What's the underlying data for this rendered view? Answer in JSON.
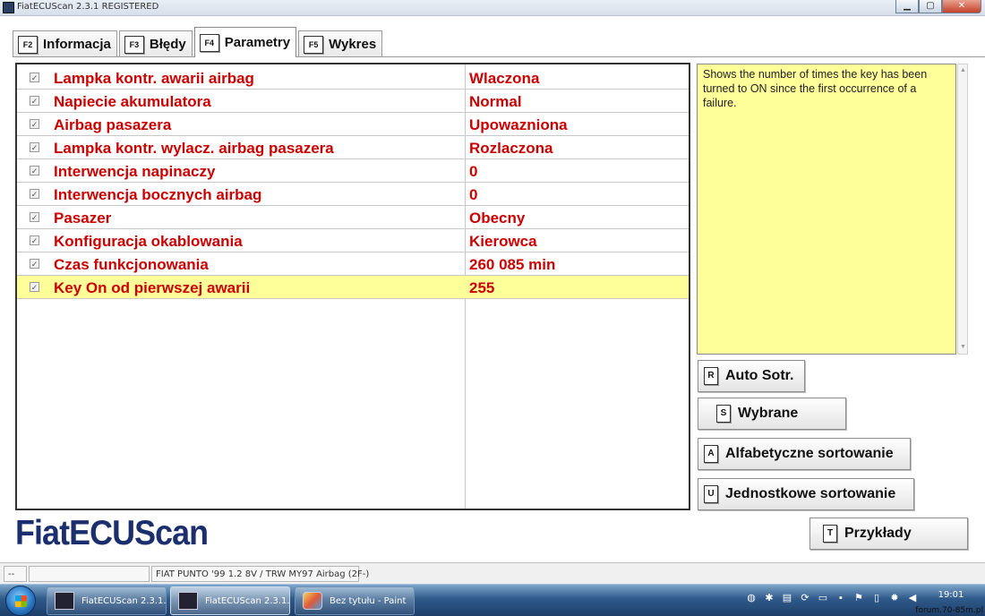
{
  "window": {
    "title": "FiatECUScan 2.3.1 REGISTERED",
    "minimize_glyph": "▁",
    "maximize_glyph": "▢",
    "close_glyph": "✕"
  },
  "tabs": [
    {
      "key": "F2",
      "label": "Informacja"
    },
    {
      "key": "F3",
      "label": "Błędy"
    },
    {
      "key": "F4",
      "label": "Parametry"
    },
    {
      "key": "F5",
      "label": "Wykres"
    }
  ],
  "parameters": [
    {
      "name": "Lampka kontr. awarii airbag",
      "value": "Wlaczona",
      "checked": true
    },
    {
      "name": "Napiecie akumulatora",
      "value": "Normal",
      "checked": true
    },
    {
      "name": "Airbag pasazera",
      "value": "Upowazniona",
      "checked": true
    },
    {
      "name": "Lampka kontr. wylacz. airbag pasazera",
      "value": "Rozlaczona",
      "checked": true
    },
    {
      "name": "Interwencja napinaczy",
      "value": "0",
      "checked": true
    },
    {
      "name": "Interwencja bocznych airbag",
      "value": "0",
      "checked": true
    },
    {
      "name": "Pasazer",
      "value": "Obecny",
      "checked": true
    },
    {
      "name": "Konfiguracja okablowania",
      "value": "Kierowca",
      "checked": true
    },
    {
      "name": "Czas funkcjonowania",
      "value": "260 085 min",
      "checked": true
    },
    {
      "name": "Key On od pierwszej awarii",
      "value": "255",
      "checked": true,
      "selected": true
    }
  ],
  "info_text": "Shows the number of times the key has been turned to ON since the first occurrence of a failure.",
  "buttons": {
    "auto_sort": {
      "key": "R",
      "label": "Auto Sotr."
    },
    "selected": {
      "key": "S",
      "label": "Wybrane"
    },
    "alpha_sort": {
      "key": "A",
      "label": "Alfabetyczne sortowanie"
    },
    "unit_sort": {
      "key": "U",
      "label": "Jednostkowe sortowanie"
    },
    "examples": {
      "key": "T",
      "label": "Przykłady"
    }
  },
  "logo_text": "FiatECUScan",
  "status": {
    "cell1": "--",
    "cell2": "",
    "vehicle": "FIAT PUNTO '99 1.2 8V / TRW MY97 Airbag (2F-)"
  },
  "taskbar": {
    "items": [
      {
        "label": "FiatECUScan 2.3.1...",
        "icon": "fiatecuscan-icon",
        "active": false
      },
      {
        "label": "FiatECUScan 2.3.1...",
        "icon": "fiatecuscan-icon",
        "active": true
      },
      {
        "label": "Bez tytułu - Paint",
        "icon": "paint-icon",
        "active": false
      }
    ],
    "clock_time": "19:01",
    "watermark": "forum.70-85m.pl"
  },
  "colors": {
    "param_text": "#cc0000",
    "selected_row": "#ffff99",
    "info_bg": "#ffff99",
    "logo": "#1b2f6e"
  }
}
